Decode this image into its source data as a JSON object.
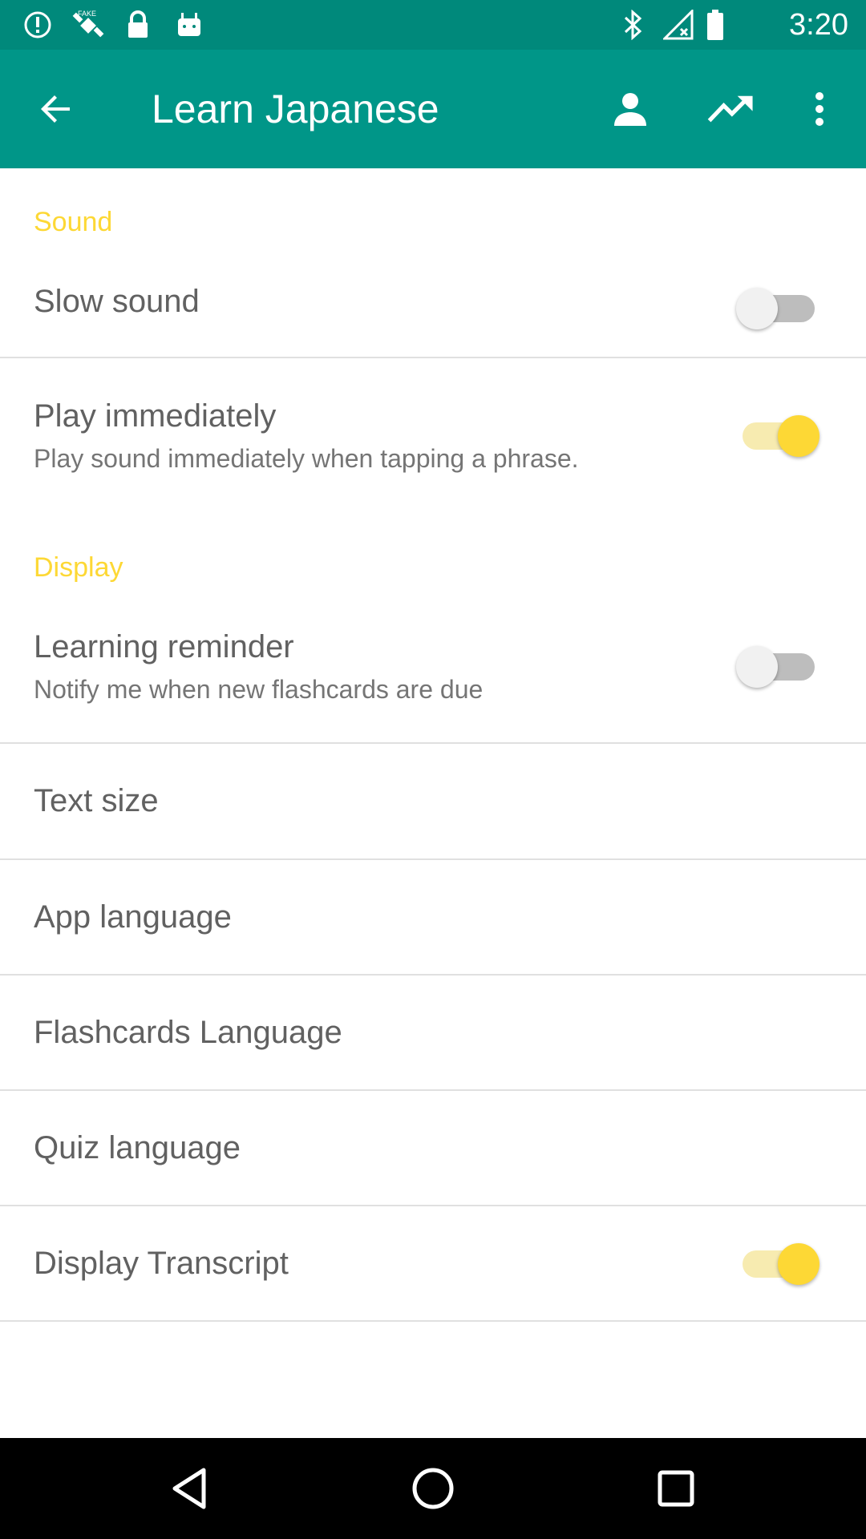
{
  "status_bar": {
    "time": "3:20",
    "icons": [
      "alert-icon",
      "fake-gps-icon",
      "lock-icon",
      "android-icon",
      "bluetooth-icon",
      "no-signal-icon",
      "battery-icon"
    ]
  },
  "app_bar": {
    "title": "Learn Japanese",
    "background": "#009688",
    "actions": [
      "back-arrow-icon",
      "person-icon",
      "trending-up-icon",
      "more-vert-icon"
    ]
  },
  "accent_color": "#fdd835",
  "sections": {
    "sound": {
      "header": "Sound",
      "slow_sound": {
        "title": "Slow sound",
        "checked": false
      },
      "play_immediately": {
        "title": "Play immediately",
        "summary": "Play sound immediately when tapping a phrase.",
        "checked": true
      }
    },
    "display": {
      "header": "Display",
      "learning_reminder": {
        "title": "Learning reminder",
        "summary": "Notify me when new flashcards are due",
        "checked": false
      },
      "text_size": {
        "title": "Text size"
      },
      "app_language": {
        "title": "App language"
      },
      "flashcards_language": {
        "title": "Flashcards Language"
      },
      "quiz_language": {
        "title": "Quiz language"
      },
      "display_transcript": {
        "title": "Display Transcript",
        "checked": true
      }
    }
  },
  "nav_bar": {
    "buttons": [
      "back-triangle-icon",
      "home-circle-icon",
      "recents-square-icon"
    ]
  }
}
